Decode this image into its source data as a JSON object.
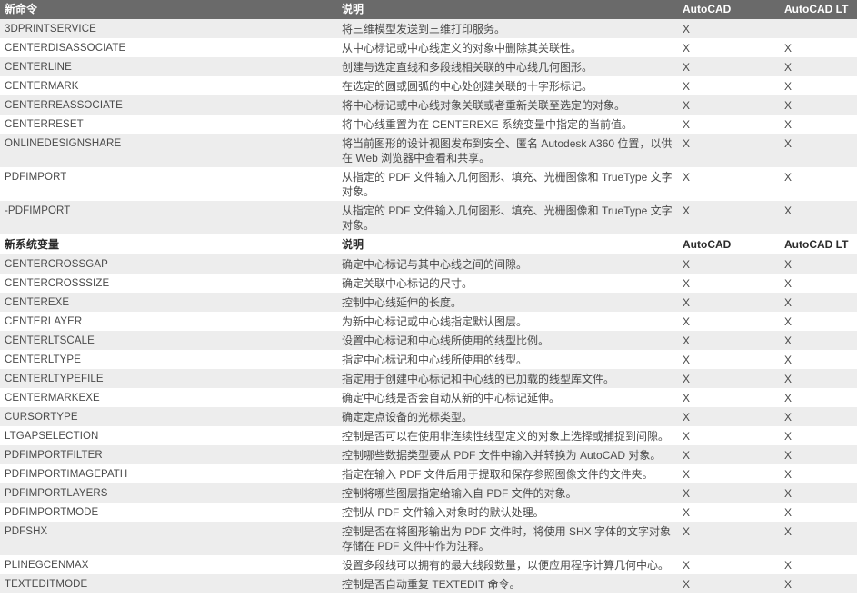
{
  "colors": {
    "header_bg": "#6a6a6a",
    "header_text": "#ffffff",
    "stripe_row_bg": "#ededed",
    "body_text": "#4a4a4a"
  },
  "sections": [
    {
      "headers": {
        "name": "新命令",
        "desc": "说明",
        "autocad": "AutoCAD",
        "autocad_lt": "AutoCAD LT"
      },
      "rows": [
        {
          "name": "3DPRINTSERVICE",
          "desc": "将三维模型发送到三维打印服务。",
          "autocad": "X",
          "autocad_lt": ""
        },
        {
          "name": "CENTERDISASSOCIATE",
          "desc": "从中心标记或中心线定义的对象中删除其关联性。",
          "autocad": "X",
          "autocad_lt": "X"
        },
        {
          "name": "CENTERLINE",
          "desc": "创建与选定直线和多段线相关联的中心线几何图形。",
          "autocad": "X",
          "autocad_lt": "X"
        },
        {
          "name": "CENTERMARK",
          "desc": "在选定的圆或圆弧的中心处创建关联的十字形标记。",
          "autocad": "X",
          "autocad_lt": "X"
        },
        {
          "name": "CENTERREASSOCIATE",
          "desc": "将中心标记或中心线对象关联或者重新关联至选定的对象。",
          "autocad": "X",
          "autocad_lt": "X"
        },
        {
          "name": "CENTERRESET",
          "desc": "将中心线重置为在 CENTEREXE 系统变量中指定的当前值。",
          "autocad": "X",
          "autocad_lt": "X"
        },
        {
          "name": "ONLINEDESIGNSHARE",
          "desc": "将当前图形的设计视图发布到安全、匿名 Autodesk A360 位置，以供在 Web 浏览器中查看和共享。",
          "autocad": "X",
          "autocad_lt": "X"
        },
        {
          "name": "PDFIMPORT",
          "desc": "从指定的 PDF 文件输入几何图形、填充、光栅图像和 TrueType 文字对象。",
          "autocad": "X",
          "autocad_lt": "X"
        },
        {
          "name": "-PDFIMPORT",
          "desc": "从指定的 PDF 文件输入几何图形、填充、光栅图像和 TrueType 文字对象。",
          "autocad": "X",
          "autocad_lt": "X"
        }
      ]
    },
    {
      "headers": {
        "name": "新系统变量",
        "desc": "说明",
        "autocad": "AutoCAD",
        "autocad_lt": "AutoCAD LT"
      },
      "rows": [
        {
          "name": "CENTERCROSSGAP",
          "desc": "确定中心标记与其中心线之间的间隙。",
          "autocad": "X",
          "autocad_lt": "X"
        },
        {
          "name": "CENTERCROSSSIZE",
          "desc": "确定关联中心标记的尺寸。",
          "autocad": "X",
          "autocad_lt": "X"
        },
        {
          "name": "CENTEREXE",
          "desc": "控制中心线延伸的长度。",
          "autocad": "X",
          "autocad_lt": "X"
        },
        {
          "name": "CENTERLAYER",
          "desc": "为新中心标记或中心线指定默认图层。",
          "autocad": "X",
          "autocad_lt": "X"
        },
        {
          "name": "CENTERLTSCALE",
          "desc": "设置中心标记和中心线所使用的线型比例。",
          "autocad": "X",
          "autocad_lt": "X"
        },
        {
          "name": "CENTERLTYPE",
          "desc": "指定中心标记和中心线所使用的线型。",
          "autocad": "X",
          "autocad_lt": "X"
        },
        {
          "name": "CENTERLTYPEFILE",
          "desc": "指定用于创建中心标记和中心线的已加载的线型库文件。",
          "autocad": "X",
          "autocad_lt": "X"
        },
        {
          "name": "CENTERMARKEXE",
          "desc": "确定中心线是否会自动从新的中心标记延伸。",
          "autocad": "X",
          "autocad_lt": "X"
        },
        {
          "name": "CURSORTYPE",
          "desc": "确定定点设备的光标类型。",
          "autocad": "X",
          "autocad_lt": "X"
        },
        {
          "name": "LTGAPSELECTION",
          "desc": "控制是否可以在使用非连续性线型定义的对象上选择或捕捉到间隙。",
          "autocad": "X",
          "autocad_lt": "X"
        },
        {
          "name": "PDFIMPORTFILTER",
          "desc": "控制哪些数据类型要从 PDF 文件中输入并转换为 AutoCAD 对象。",
          "autocad": "X",
          "autocad_lt": "X"
        },
        {
          "name": "PDFIMPORTIMAGEPATH",
          "desc": "指定在输入 PDF 文件后用于提取和保存参照图像文件的文件夹。",
          "autocad": "X",
          "autocad_lt": "X"
        },
        {
          "name": "PDFIMPORTLAYERS",
          "desc": "控制将哪些图层指定给输入自 PDF 文件的对象。",
          "autocad": "X",
          "autocad_lt": "X"
        },
        {
          "name": "PDFIMPORTMODE",
          "desc": "控制从 PDF 文件输入对象时的默认处理。",
          "autocad": "X",
          "autocad_lt": "X"
        },
        {
          "name": "PDFSHX",
          "desc": "控制是否在将图形输出为 PDF 文件时，将使用 SHX 字体的文字对象存储在 PDF 文件中作为注释。",
          "autocad": "X",
          "autocad_lt": "X"
        },
        {
          "name": "PLINEGCENMAX",
          "desc": "设置多段线可以拥有的最大线段数量，以便应用程序计算几何中心。",
          "autocad": "X",
          "autocad_lt": "X"
        },
        {
          "name": "TEXTEDITMODE",
          "desc": "控制是否自动重复 TEXTEDIT 命令。",
          "autocad": "X",
          "autocad_lt": "X"
        }
      ]
    }
  ]
}
